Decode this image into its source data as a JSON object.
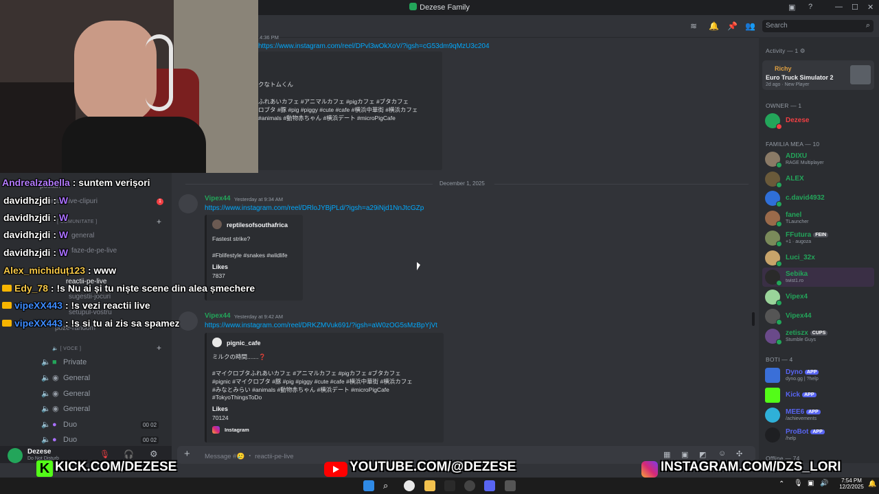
{
  "window": {
    "title": "Dezese Family"
  },
  "search": {
    "placeholder": "Search"
  },
  "sidebar": {
    "channels": [
      "anunturi-live-clipuri",
      "general",
      "faze-de-pe-live",
      "reactii-pe-live",
      "sugestii-jocuri",
      "setupul-vostru",
      "poze-random"
    ],
    "category_community": "[ COMUNITATE ]",
    "category_voice": "[ VOCE ]",
    "voice_channels": [
      "Private",
      "General",
      "General",
      "General",
      "Duo",
      "Duo"
    ],
    "duo_counts": [
      "00",
      "02"
    ],
    "unread_badge": "1",
    "partial_label": "postari"
  },
  "user": {
    "name": "Dezese",
    "status": "Do Not Disturb"
  },
  "messages": {
    "top_link": "https://www.instagram.com/reel/DPvl3wOkXoV/?igsh=cG53dm9qMzU3c204",
    "top_time": "4:36 PM",
    "top_lines": [
      "クなトムくん",
      "ふれあいカフェ #アニマルカフェ #pigカフェ #ブタカフェ",
      "ロブタ #豚 #pig #piggy #cute #cafe #横浜中華街 #横浜カフェ",
      "#animals #動物赤ちゃん #横浜デート #microPigCafe"
    ],
    "divider": "December 1, 2025",
    "m1": {
      "author": "Vipex44",
      "time": "Yesterday at 9:34 AM",
      "link": "https://www.instagram.com/reel/DRloJYBjPLd/?igsh=a29iNjd1NnJtcGZp",
      "embed_author": "reptilesofsouthafrica",
      "embed_title": "Fastest strike?",
      "embed_tags": "#Fblifestyle #snakes #wildlife",
      "likes_label": "Likes",
      "likes": "7837"
    },
    "m2": {
      "author": "Vipex44",
      "time": "Yesterday at 9:42 AM",
      "link": "https://www.instagram.com/reel/DRKZMVuk691/?igsh=aW0zOG5sMzBpYjVt",
      "embed_author": "pignic_cafe",
      "line1": "ミルクの時間.......❓",
      "line2": "#マイクロブタふれあいカフェ #アニマルカフェ #pigカフェ #ブタカフェ",
      "line3": "#pignic #マイクロブタ #豚 #pig #piggy #cute #cafe #横浜中華街 #横浜カフェ",
      "line4": "#みなとみらい #animals #動物赤ちゃん #横浜デート #microPigCafe",
      "line5": "#TokyoThingsToDo",
      "likes_label": "Likes",
      "likes": "70124",
      "footer": "Instagram"
    },
    "composer_placeholder": "Message #🥲 ・ reactii-pe-live"
  },
  "members": {
    "activity_header": "Activity — 1",
    "activity_name": "Richy",
    "activity_game": "Euro Truck Simulator 2",
    "activity_meta": "2d ago · New Player",
    "owner_header": "OWNER — 1",
    "owner": "Dezese",
    "family_header": "FAMILIA MEA — 10",
    "family": [
      {
        "name": "ADIXU",
        "status": "RAGE Multiplayer",
        "color": "#23a55a"
      },
      {
        "name": "ALEX",
        "status": "",
        "color": "#23a55a"
      },
      {
        "name": "c.david4932",
        "status": "",
        "color": "#23a55a"
      },
      {
        "name": "fanel",
        "status": "TLauncher",
        "color": "#23a55a"
      },
      {
        "name": "FFutura",
        "status": "+1 · augoza",
        "color": "#23a55a"
      },
      {
        "name": "Luci_32x",
        "status": "",
        "color": "#23a55a"
      },
      {
        "name": "Sebika",
        "status": "twist1.ro",
        "color": "#23a55a"
      },
      {
        "name": "Vipex4",
        "status": "",
        "color": "#23a55a"
      },
      {
        "name": "Vipex44",
        "status": "",
        "color": "#23a55a"
      },
      {
        "name": "zetiszx",
        "status": "Stumble Guys",
        "color": "#23a55a"
      }
    ],
    "ffutura_tag": "FEIN",
    "zetiszx_tag": "CUPS",
    "boti_header": "BOTI — 4",
    "bots": [
      {
        "name": "Dyno",
        "status": "dyno.gg | ?help"
      },
      {
        "name": "Kick",
        "status": ""
      },
      {
        "name": "MEE6",
        "status": "/achievements"
      },
      {
        "name": "ProBot",
        "status": "/help"
      }
    ],
    "app_badge": "APP",
    "offline_header": "Offline — 74"
  },
  "overlay_chat": [
    {
      "user": "Andrealzabella",
      "sep": " : ",
      "msg": "suntem verișori",
      "color": "purple",
      "crown": false
    },
    {
      "user": "davidhzjdi",
      "sep": " : ",
      "msg": "",
      "color": "white",
      "crown": false
    },
    {
      "user": "davidhzjdi",
      "sep": " : ",
      "msg": "",
      "color": "white",
      "crown": false
    },
    {
      "user": "davidhzjdi",
      "sep": " : ",
      "msg": "",
      "color": "white",
      "crown": false
    },
    {
      "user": "davidhzjdi",
      "sep": " : ",
      "msg": "",
      "color": "white",
      "crown": false
    },
    {
      "user": "Alex_michiduț123",
      "sep": " : ",
      "msg": "www",
      "color": "yellow",
      "crown": false
    },
    {
      "user": "Edy_78",
      "sep": " : ",
      "msg": "!s Nu ai și tu niște scene din alea șmechere",
      "color": "yellow",
      "crown": true
    },
    {
      "user": "vipeXX443",
      "sep": " : ",
      "msg": "!s vezi reactii live",
      "color": "blue",
      "crown": true
    },
    {
      "user": "vipeXX443",
      "sep": " : ",
      "msg": "!s si tu ai zis sa spamez",
      "color": "blue",
      "crown": true
    }
  ],
  "banners": {
    "kick": "KICK.COM/DEZESE",
    "youtube": "YOUTUBE.COM/@DEZESE",
    "instagram": "INSTAGRAM.COM/DZS_LORI"
  },
  "taskbar": {
    "time": "7:54 PM",
    "date": "12/2/2025"
  },
  "colors": {
    "kick_green": "#53fc18",
    "online": "#23a55a",
    "link": "#00a8fc",
    "brand": "#5865f2"
  }
}
